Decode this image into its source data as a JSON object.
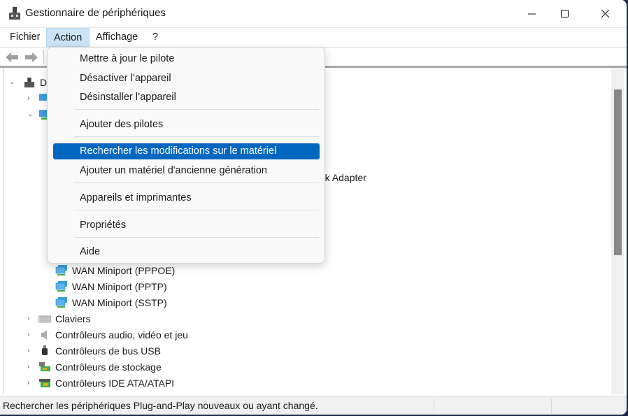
{
  "window": {
    "title": "Gestionnaire de périphériques",
    "controls": {
      "minimize": "minimize-icon",
      "maximize": "maximize-icon",
      "close": "close-icon"
    }
  },
  "menubar": [
    {
      "label": "Fichier"
    },
    {
      "label": "Action",
      "open": true
    },
    {
      "label": "Affichage"
    },
    {
      "label": "?"
    }
  ],
  "toolbar": {
    "back": "back-arrow-icon",
    "forward": "forward-arrow-icon"
  },
  "action_menu": {
    "items": [
      {
        "label": "Mettre à jour le pilote"
      },
      {
        "label": "Désactiver l’appareil"
      },
      {
        "label": "Désinstaller l’appareil"
      },
      {
        "label": "Ajouter des pilotes"
      },
      {
        "label": "Rechercher les modifications sur le matériel",
        "highlighted": true
      },
      {
        "label": "Ajouter un matériel d'ancienne génération"
      },
      {
        "label": "Appareils et imprimantes"
      },
      {
        "label": "Propriétés"
      },
      {
        "label": "Aide"
      }
    ],
    "highlight_color": "#0067c0"
  },
  "tree": {
    "root": "D",
    "partial_row": "rk Adapter",
    "wan": [
      "WAN Miniport (PPPOE)",
      "WAN Miniport (PPTP)",
      "WAN Miniport (SSTP)"
    ],
    "categories": [
      {
        "label": "Claviers",
        "icon": "keyboard-icon"
      },
      {
        "label": "Contrôleurs audio, vidéo et jeu",
        "icon": "speaker-icon"
      },
      {
        "label": "Contrôleurs de bus USB",
        "icon": "usb-icon"
      },
      {
        "label": "Contrôleurs de stockage",
        "icon": "storage-controller-icon"
      },
      {
        "label": "Contrôleurs IDE ATA/ATAPI",
        "icon": "ide-controller-icon"
      }
    ]
  },
  "status": {
    "text": "Rechercher les périphériques Plug-and-Play nouveaux ou ayant changé."
  }
}
